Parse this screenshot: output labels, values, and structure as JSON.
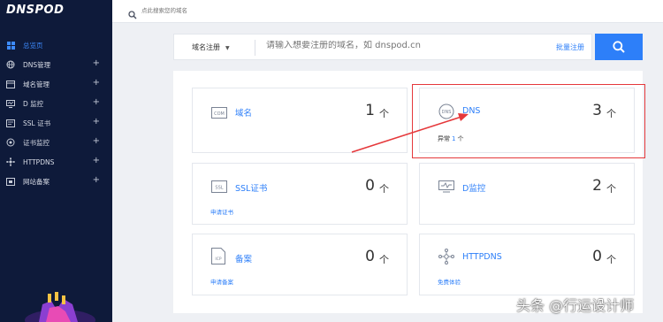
{
  "sidebar": {
    "logo": "DNSPOD",
    "items": [
      {
        "label": "总览页",
        "icon": "dashboard-icon",
        "active": true,
        "has_plus": false
      },
      {
        "label": "DNS管理",
        "icon": "globe-icon",
        "active": false,
        "has_plus": true
      },
      {
        "label": "域名管理",
        "icon": "browser-icon",
        "active": false,
        "has_plus": true
      },
      {
        "label": "D 监控",
        "icon": "monitor-icon",
        "active": false,
        "has_plus": true
      },
      {
        "label": "SSL 证书",
        "icon": "certificate-icon",
        "active": false,
        "has_plus": true
      },
      {
        "label": "证书监控",
        "icon": "target-icon",
        "active": false,
        "has_plus": true
      },
      {
        "label": "HTTPDNS",
        "icon": "network-icon",
        "active": false,
        "has_plus": true
      },
      {
        "label": "网站备案",
        "icon": "record-icon",
        "active": false,
        "has_plus": true
      }
    ]
  },
  "topbar": {
    "search_placeholder": "点此搜索您的域名"
  },
  "domain_search": {
    "select_value": "域名注册",
    "placeholder": "请输入想要注册的域名，如 dnspod.cn",
    "batch_label": "批量注册"
  },
  "cards": {
    "domain": {
      "title": "域名",
      "count": "1",
      "unit": "个",
      "icon_text": "COM"
    },
    "dns": {
      "title": "DNS",
      "count": "3",
      "unit": "个",
      "status_label": "异常",
      "status_count": "1",
      "status_unit": "个",
      "icon_text": "DNS"
    },
    "ssl": {
      "title": "SSL证书",
      "count": "0",
      "unit": "个",
      "link": "申请证书",
      "icon_text": "SSL"
    },
    "dmon": {
      "title": "D监控",
      "count": "2",
      "unit": "个"
    },
    "beian": {
      "title": "备案",
      "count": "0",
      "unit": "个",
      "link": "申请备案",
      "icon_text": "ICP"
    },
    "httpdns": {
      "title": "HTTPDNS",
      "count": "0",
      "unit": "个",
      "link": "免费体验"
    }
  },
  "colors": {
    "accent": "#2d7ff9",
    "sidebar_bg": "#0e1a3a",
    "highlight": "#e5383b"
  },
  "watermark": "头条 @行运设计师"
}
